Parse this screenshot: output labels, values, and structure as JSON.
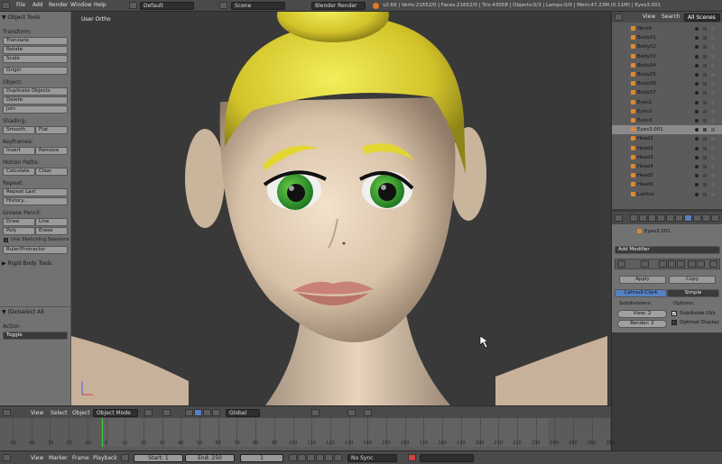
{
  "topbar": {
    "menus": [
      "File",
      "Add",
      "Render",
      "Window",
      "Help"
    ],
    "layout": "Default",
    "scene": "Scene",
    "engine": "Blender Render",
    "stats": "v2.69 | Verts:21652/0 | Faces:21652/0 | Tris:43058 | Objects:0/3 | Lamps:0/0 | Mem:47.23M (0.11M) | Eyes3.001"
  },
  "tools": {
    "title": "Object Tools",
    "transform_label": "Transform:",
    "translate": "Translate",
    "rotate": "Rotate",
    "scale": "Scale",
    "origin": "Origin",
    "object_label": "Object:",
    "duplicate": "Duplicate Objects",
    "delete": "Delete",
    "join": "Join",
    "shading_label": "Shading:",
    "smooth": "Smooth",
    "flat": "Flat",
    "keyframes_label": "Keyframes:",
    "insert": "Insert",
    "remove": "Remove",
    "motion_paths_label": "Motion Paths:",
    "calculate": "Calculate",
    "clear": "Clear",
    "repeat_label": "Repeat:",
    "repeat_last": "Repeat Last",
    "history": "History...",
    "grease_label": "Grease Pencil:",
    "draw": "Draw",
    "line": "Line",
    "poly": "Poly",
    "erase": "Erase",
    "sketching": "Use Sketching Sessions",
    "ruler": "Ruler/Protractor",
    "rigid_body": "Rigid Body Tools",
    "deselect_all": "(De)select All",
    "action_label": "Action",
    "action_value": "Toggle"
  },
  "viewport": {
    "label": "User Ortho"
  },
  "outliner": {
    "menu_view": "View",
    "menu_search": "Search",
    "scope": "All Scenes",
    "rows": [
      "World",
      "Body01",
      "Body02",
      "Body03",
      "Body04",
      "Body05",
      "Body06",
      "Body07",
      "Eyes1",
      "Eyes2",
      "Eyes3",
      "Eyes3.001",
      "Head1",
      "Head2",
      "Head3",
      "Head4",
      "Head5",
      "Head6",
      "Lattice"
    ],
    "selected_index": 11
  },
  "properties": {
    "object_name": "Eyes3.001",
    "add_modifier": "Add Modifier",
    "apply": "Apply",
    "copy": "Copy",
    "tab_catmull": "Catmull-Clark",
    "tab_simple": "Simple",
    "subdivisions_label": "Subdivisions:",
    "view_label": "View:",
    "view_value": "2",
    "render_label": "Render:",
    "render_value": "2",
    "options_label": "Options:",
    "subdivide_uvs": "Subdivide UVs",
    "optimal_display": "Optimal Display"
  },
  "viewheader": {
    "view": "View",
    "select": "Select",
    "object": "Object",
    "mode": "Object Mode",
    "pivot": "Global"
  },
  "timeline": {
    "ticks": [
      "-50",
      "-40",
      "-30",
      "-20",
      "-10",
      "0",
      "10",
      "20",
      "30",
      "40",
      "50",
      "60",
      "70",
      "80",
      "90",
      "100",
      "110",
      "120",
      "130",
      "140",
      "150",
      "160",
      "170",
      "180",
      "190",
      "200",
      "210",
      "220",
      "230",
      "240",
      "250",
      "260",
      "280"
    ]
  },
  "footer": {
    "view": "View",
    "marker": "Marker",
    "frame": "Frame",
    "playback": "Playback",
    "start": "Start: 1",
    "end": "End: 250",
    "current": "1",
    "sync": "No Sync"
  }
}
